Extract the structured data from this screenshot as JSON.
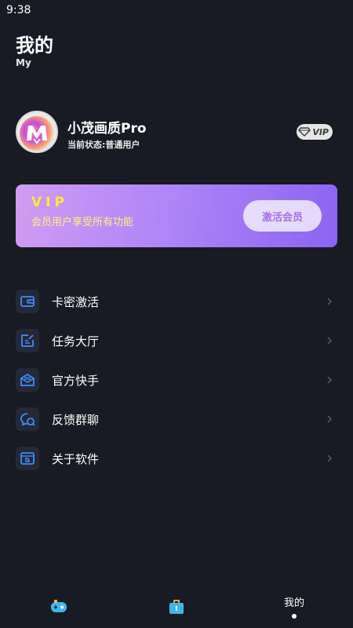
{
  "status_bar": {
    "time": "9:38"
  },
  "header": {
    "title": "我的",
    "subtitle": "My"
  },
  "profile": {
    "username": "小茂画质Pro",
    "status": "当前状态:普通用户",
    "vip_badge": "VIP",
    "avatar_icon": "letter-m-logo"
  },
  "vip_card": {
    "title": "VIP",
    "description": "会员用户享受所有功能",
    "button_label": "激活会员"
  },
  "menu": {
    "items": [
      {
        "label": "卡密激活",
        "icon": "wallet-icon"
      },
      {
        "label": "任务大厅",
        "icon": "edit-note-icon"
      },
      {
        "label": "官方快手",
        "icon": "mail-icon"
      },
      {
        "label": "反馈群聊",
        "icon": "chat-bubbles-icon"
      },
      {
        "label": "关于软件",
        "icon": "info-app-icon"
      }
    ]
  },
  "bottom_nav": {
    "items": [
      {
        "label": "",
        "icon": "gamepad-icon"
      },
      {
        "label": "",
        "icon": "toolbox-icon"
      },
      {
        "label": "我的",
        "icon": ""
      }
    ],
    "active_index": 2
  },
  "colors": {
    "background": "#181b24",
    "icon_blue": "#3f8cff",
    "vip_yellow": "#ffe63c",
    "vip_purple": "#a86fe8"
  }
}
